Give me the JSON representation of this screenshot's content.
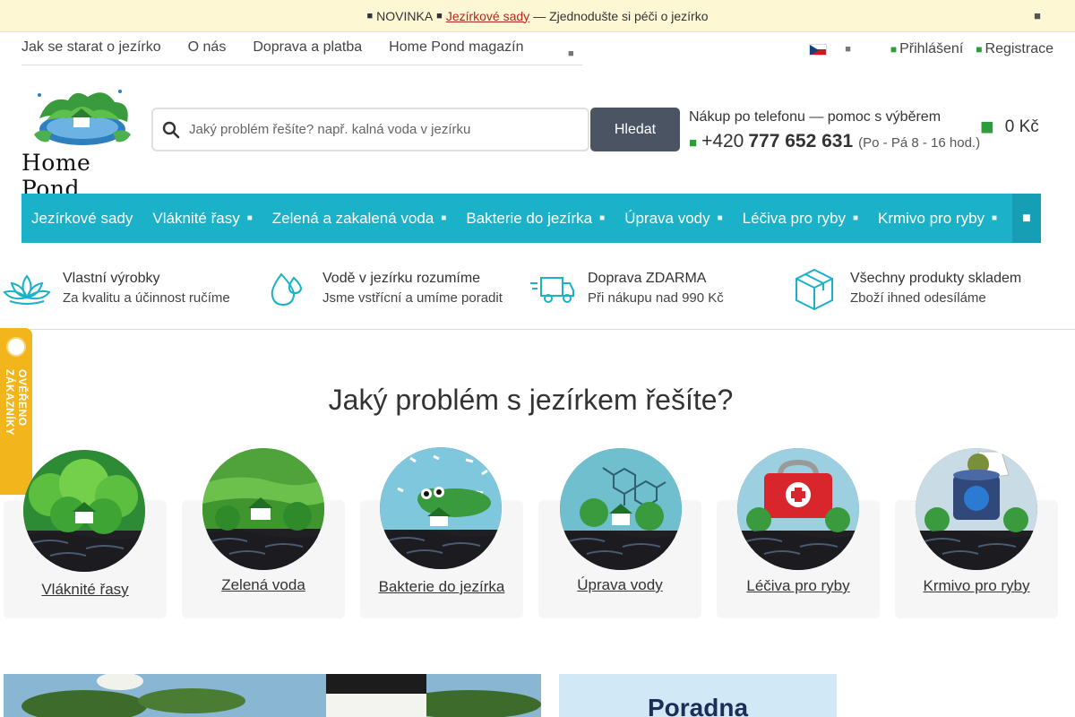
{
  "announcement": {
    "prefix": "NOVINKA",
    "link": "Jezírkové sady",
    "suffix": "— Zjednodušte si péči o jezírko",
    "icon": "star-icon",
    "close_icon": "close-icon"
  },
  "topnav": {
    "links": [
      "Jak se starat o jezírko",
      "O nás",
      "Doprava a platba",
      "Home Pond magazín"
    ]
  },
  "account": {
    "login": "Přihlášení",
    "register": "Registrace"
  },
  "logo": {
    "text": "Home Pond"
  },
  "search": {
    "placeholder": "Jaký problém řešíte? např. kalná voda v jezírku",
    "button": "Hledat"
  },
  "phone": {
    "label": "Nákup po telefonu — pomoc s výběrem",
    "prefix": "+420",
    "number": "777 652 631",
    "hours": "(Po - Pá 8 - 16 hod.)"
  },
  "cart": {
    "value": "0 Kč"
  },
  "menu": {
    "items": [
      {
        "label": "Jezírkové sady",
        "dropdown": false
      },
      {
        "label": "Vláknité řasy",
        "dropdown": true
      },
      {
        "label": "Zelená a zakalená voda",
        "dropdown": true
      },
      {
        "label": "Bakterie do jezírka",
        "dropdown": true
      },
      {
        "label": "Úprava vody",
        "dropdown": true
      },
      {
        "label": "Léčiva pro ryby",
        "dropdown": true
      },
      {
        "label": "Krmivo pro ryby",
        "dropdown": true
      }
    ]
  },
  "benefits": [
    {
      "title": "Vlastní výrobky",
      "text": "Za kvalitu a účinnost ručíme",
      "icon": "lotus-icon"
    },
    {
      "title": "Vodě v jezírku rozumíme",
      "text": "Jsme vstřícní a umíme poradit",
      "icon": "water-drops-icon"
    },
    {
      "title": "Doprava ZDARMA",
      "text": "Při nákupu nad 990 Kč",
      "icon": "delivery-truck-icon"
    },
    {
      "title": "Všechny produkty skladem",
      "text": "Zboží ihned odesíláme",
      "icon": "package-box-icon"
    }
  ],
  "verified": {
    "label": "OVĚŘENO ZÁKAZNÍKY"
  },
  "problem": {
    "title": "Jaký problém s jezírkem řešíte?",
    "categories": [
      {
        "label": "Vláknité řasy",
        "icon": "algae-pond-icon"
      },
      {
        "label": "Zelená voda",
        "icon": "green-water-pond-icon"
      },
      {
        "label": "Bakterie do jezírka",
        "icon": "bacteria-pond-icon"
      },
      {
        "label": "Úprava vody",
        "icon": "water-treatment-pond-icon"
      },
      {
        "label": "Léčiva pro ryby",
        "icon": "fish-medicine-pond-icon"
      },
      {
        "label": "Krmivo pro ryby",
        "icon": "fish-food-pond-icon"
      }
    ]
  },
  "banners": {
    "right_title": "Poradna"
  },
  "colors": {
    "accent": "#1bb1c8",
    "green": "#2e9c3a",
    "search_button": "#4a5462",
    "announcement_bg": "#fdf7d3",
    "verified_tab": "#f2b51b"
  }
}
